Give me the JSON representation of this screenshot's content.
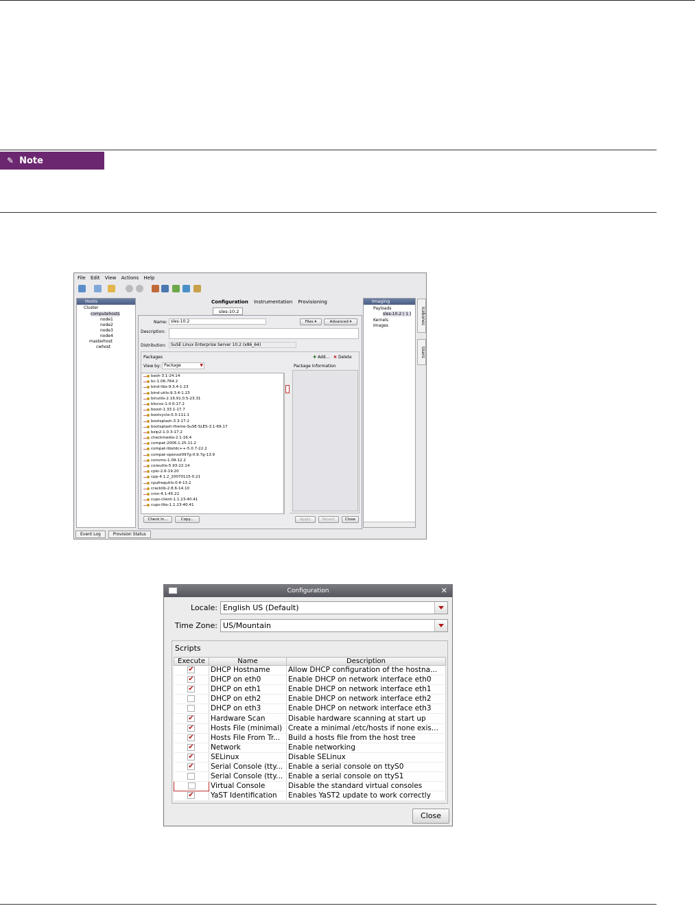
{
  "note": {
    "label": "Note"
  },
  "shot1": {
    "menu": [
      "File",
      "Edit",
      "View",
      "Actions",
      "Help"
    ],
    "hosts_panel": {
      "title": "Hosts",
      "tree": [
        "Cluster",
        "computehosts",
        "node1",
        "node2",
        "node3",
        "node4",
        "masterhost",
        "cwhost"
      ]
    },
    "tabs": [
      "Configuration",
      "Instrumentation",
      "Provisioning"
    ],
    "subtab": "sles-10.2",
    "name_label": "Name:",
    "name_value": "sles-10.2",
    "files_button": "Files",
    "advanced_button": "Advanced",
    "description_label": "Description:",
    "distribution_label": "Distribution:",
    "distribution_value": "SuSE Linux Enterprise Server 10.2 (x86_64)",
    "packages_label": "Packages",
    "add_button": "Add...",
    "delete_button": "Delete",
    "viewby_label": "View by:",
    "viewby_value": "Package",
    "package_info_label": "Package Information",
    "packages": [
      "bash-3.1-24.14",
      "bc-1.06-764.2",
      "bind-libs-9.3.4-1.23",
      "bind-utils-9.3.4-1.23",
      "binutils-2.16.91.0.5-23.31",
      "blocxx-1.0.0-17.2",
      "boost-1.33.1-17.7",
      "bootcycle-0.3-111.1",
      "bootsplash-3.3-17.2",
      "bootsplash-theme-SuSE-SLES-3.1-69.17",
      "bzip2-1.0.3-17.2",
      "checkmedia-2.1-16.4",
      "compat-2006.1.25-11.2",
      "compat-libstdc++-5.0.7-22.2",
      "compat-openssl097g-0.9.7g-13.9",
      "convmv-1.09-12.2",
      "coreutils-5.93-22.14",
      "cpio-2.6-19.20",
      "cpp-4.1.2_20070115-0.21",
      "cpufrequtils-0.4-13.2",
      "cracklib-2.8.6-14.10",
      "cron-4.1-45.22",
      "cups-client-1.1.23-40.41",
      "cups-libs-1.1.23-40.41"
    ],
    "checkin_button": "Check In...",
    "copy_button": "Copy...",
    "apply_button": "Apply",
    "revert_button": "Revert",
    "close_button": "Close",
    "imaging_panel": {
      "title": "Imaging",
      "tree": [
        "Payloads",
        "sles-10.2 ( 1 )",
        "Kernels",
        "Images"
      ]
    },
    "side_tabs": [
      "Icebones",
      "Users"
    ],
    "bottom_tabs": [
      "Event Log",
      "Provision Status"
    ]
  },
  "shot2": {
    "title": "Configuration",
    "locale_label": "Locale:",
    "locale_value": "English US (Default)",
    "timezone_label": "Time Zone:",
    "timezone_value": "US/Mountain",
    "scripts_label": "Scripts",
    "columns": [
      "Execute",
      "Name",
      "Description"
    ],
    "rows": [
      {
        "execute": true,
        "name": "DHCP Hostname",
        "description": "Allow DHCP configuration of the hostna..."
      },
      {
        "execute": true,
        "name": "DHCP on eth0",
        "description": "Enable DHCP on network interface eth0"
      },
      {
        "execute": true,
        "name": "DHCP on eth1",
        "description": "Enable DHCP on network interface eth1"
      },
      {
        "execute": false,
        "name": "DHCP on eth2",
        "description": "Enable DHCP on network interface eth2"
      },
      {
        "execute": false,
        "name": "DHCP on eth3",
        "description": "Enable DHCP on network interface eth3"
      },
      {
        "execute": true,
        "name": "Hardware Scan",
        "description": "Disable hardware scanning at start up"
      },
      {
        "execute": true,
        "name": "Hosts File (minimal)",
        "description": "Create a minimal /etc/hosts if none exis..."
      },
      {
        "execute": true,
        "name": "Hosts File From Tr...",
        "description": "Build a hosts file from the host tree"
      },
      {
        "execute": true,
        "name": "Network",
        "description": "Enable networking"
      },
      {
        "execute": true,
        "name": "SELinux",
        "description": "Disable SELinux"
      },
      {
        "execute": true,
        "name": "Serial Console (tty...",
        "description": "Enable a serial console on ttyS0"
      },
      {
        "execute": false,
        "name": "Serial Console (tty...",
        "description": "Enable a serial console on ttyS1"
      },
      {
        "execute": false,
        "name": "Virtual Console",
        "description": "Disable the standard virtual consoles"
      },
      {
        "execute": true,
        "name": "YaST Identification",
        "description": "Enables YaST2 update to work correctly"
      }
    ],
    "close_button": "Close"
  }
}
